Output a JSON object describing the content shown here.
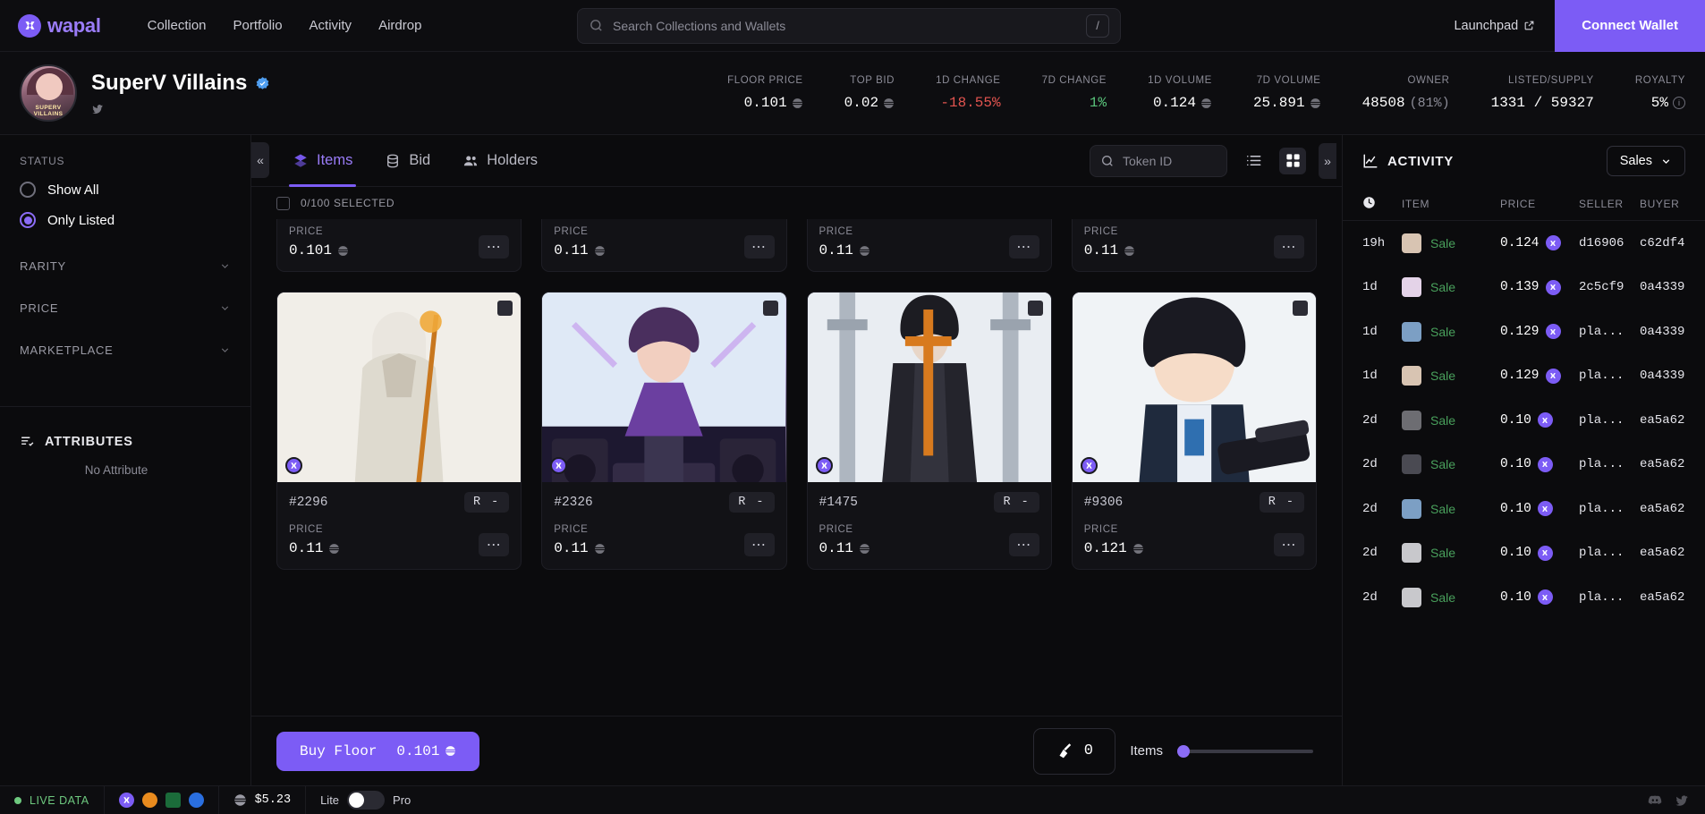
{
  "brand": {
    "name": "wapal",
    "accent": "#7c5cf5"
  },
  "topnav": {
    "links": [
      "Collection",
      "Portfolio",
      "Activity",
      "Airdrop"
    ],
    "search_placeholder": "Search Collections and Wallets",
    "search_shortcut": "/",
    "launchpad_label": "Launchpad",
    "connect_label": "Connect Wallet"
  },
  "collection": {
    "name": "SuperV Villains",
    "verified": true,
    "avatar_caption": "SUPERV VILLAINS",
    "stats": [
      {
        "label": "FLOOR PRICE",
        "value": "0.101",
        "currency": "apt",
        "tone": "default"
      },
      {
        "label": "TOP BID",
        "value": "0.02",
        "currency": "apt",
        "tone": "default"
      },
      {
        "label": "1D CHANGE",
        "value": "-18.55%",
        "currency": "",
        "tone": "negative"
      },
      {
        "label": "7D CHANGE",
        "value": "1%",
        "currency": "",
        "tone": "positive"
      },
      {
        "label": "1D VOLUME",
        "value": "0.124",
        "currency": "apt",
        "tone": "default"
      },
      {
        "label": "7D VOLUME",
        "value": "25.891",
        "currency": "apt",
        "tone": "default"
      },
      {
        "label": "OWNER",
        "value": "48508",
        "sub": "(81%)",
        "currency": "",
        "tone": "default"
      },
      {
        "label": "LISTED/SUPPLY",
        "value": "1331 / 59327",
        "currency": "",
        "tone": "default"
      },
      {
        "label": "ROYALTY",
        "value": "5%",
        "currency": "",
        "tone": "default",
        "info": true
      }
    ]
  },
  "sidebar": {
    "status_title": "STATUS",
    "status_options": [
      {
        "label": "Show All",
        "selected": false
      },
      {
        "label": "Only Listed",
        "selected": true
      }
    ],
    "accordions": [
      "RARITY",
      "PRICE",
      "MARKETPLACE"
    ],
    "attributes_title": "ATTRIBUTES",
    "attributes_empty": "No Attribute"
  },
  "tabs": [
    {
      "label": "Items",
      "icon": "layers-icon",
      "active": true
    },
    {
      "label": "Bid",
      "icon": "coins-icon",
      "active": false
    },
    {
      "label": "Holders",
      "icon": "people-icon",
      "active": false
    }
  ],
  "toolbar": {
    "collapse_left": "«",
    "collapse_right": "»",
    "token_search_placeholder": "Token ID",
    "view_list": "list-view-icon",
    "view_grid": "grid-view-icon"
  },
  "selection": {
    "label": "0/100 SELECTED",
    "checked": false
  },
  "grid": {
    "partial_row": [
      {
        "price_label": "PRICE",
        "price": "0.101",
        "menu": "⋯"
      },
      {
        "price_label": "PRICE",
        "price": "0.11",
        "menu": "⋯"
      },
      {
        "price_label": "PRICE",
        "price": "0.11",
        "menu": "⋯"
      },
      {
        "price_label": "PRICE",
        "price": "0.11",
        "menu": "⋯"
      }
    ],
    "cards": [
      {
        "token_id": "#2296",
        "rank": "R -",
        "price_label": "PRICE",
        "price": "0.11",
        "menu": "⋯",
        "art": "robed-figure-staff"
      },
      {
        "token_id": "#2326",
        "rank": "R -",
        "price_label": "PRICE",
        "price": "0.11",
        "menu": "⋯",
        "art": "dj-speakers-purple"
      },
      {
        "token_id": "#1475",
        "rank": "R -",
        "price_label": "PRICE",
        "price": "0.11",
        "menu": "⋯",
        "art": "nun-cross-dark"
      },
      {
        "token_id": "#9306",
        "rank": "R -",
        "price_label": "PRICE",
        "price": "0.121",
        "menu": "⋯",
        "art": "schoolgirl-weapon"
      }
    ]
  },
  "actionbar": {
    "buy_floor_label": "Buy Floor",
    "buy_floor_price": "0.101",
    "sweep_count": "0",
    "sweep_label": "Items",
    "slider_value": 0
  },
  "activity": {
    "title": "ACTIVITY",
    "filter": "Sales",
    "columns": [
      "",
      "ITEM",
      "PRICE",
      "SELLER",
      "BUYER"
    ],
    "rows": [
      {
        "time": "19h",
        "kind": "Sale",
        "price": "0.124",
        "seller": "d16906",
        "buyer": "c62df4",
        "thumb": "#d8c4b2"
      },
      {
        "time": "1d",
        "kind": "Sale",
        "price": "0.139",
        "seller": "2c5cf9",
        "buyer": "0a4339",
        "thumb": "#e4d3e8"
      },
      {
        "time": "1d",
        "kind": "Sale",
        "price": "0.129",
        "seller": "pla...",
        "buyer": "0a4339",
        "thumb": "#7c9fc4"
      },
      {
        "time": "1d",
        "kind": "Sale",
        "price": "0.129",
        "seller": "pla...",
        "buyer": "0a4339",
        "thumb": "#d8c4b2"
      },
      {
        "time": "2d",
        "kind": "Sale",
        "price": "0.10",
        "seller": "pla...",
        "buyer": "ea5a62",
        "thumb": "#6d6d72"
      },
      {
        "time": "2d",
        "kind": "Sale",
        "price": "0.10",
        "seller": "pla...",
        "buyer": "ea5a62",
        "thumb": "#4a4a52"
      },
      {
        "time": "2d",
        "kind": "Sale",
        "price": "0.10",
        "seller": "pla...",
        "buyer": "ea5a62",
        "thumb": "#7c9fc4"
      },
      {
        "time": "2d",
        "kind": "Sale",
        "price": "0.10",
        "seller": "pla...",
        "buyer": "ea5a62",
        "thumb": "#c8c8cc"
      },
      {
        "time": "2d",
        "kind": "Sale",
        "price": "0.10",
        "seller": "pla...",
        "buyer": "ea5a62",
        "thumb": "#c8c8cc"
      }
    ]
  },
  "statusbar": {
    "live_label": "LIVE DATA",
    "chains": [
      "wapal-chain",
      "aptos-orange-chain",
      "movement-chain",
      "sui-blue-chain"
    ],
    "apt_price": "$5.23",
    "mode_left": "Lite",
    "mode_right": "Pro",
    "mode_is_pro": false
  }
}
